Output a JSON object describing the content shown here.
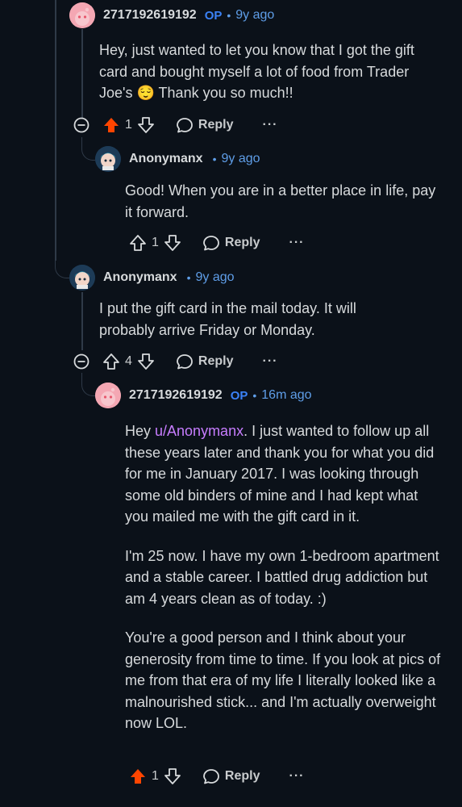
{
  "comments": [
    {
      "author": "2717192619192",
      "op_badge": "OP",
      "separator": "•",
      "time": "9y ago",
      "body": "Hey, just wanted to let you know that I got the gift card and bought myself a lot of food from Trader Joe's 😌 Thank you so much!!",
      "votes": "1",
      "upvoted": true,
      "reply_label": "Reply",
      "more_label": "···"
    },
    {
      "author": "Anonymanx",
      "separator": "•",
      "time": "9y ago",
      "body": "Good! When you are in a better place in life, pay it forward.",
      "votes": "1",
      "upvoted": false,
      "reply_label": "Reply",
      "more_label": "···"
    },
    {
      "author": "Anonymanx",
      "separator": "•",
      "time": "9y ago",
      "body": "I put the gift card in the mail today. It will probably arrive Friday or Monday.",
      "votes": "4",
      "upvoted": false,
      "reply_label": "Reply",
      "more_label": "···"
    },
    {
      "author": "2717192619192",
      "op_badge": "OP",
      "separator": "•",
      "time": "16m ago",
      "body_p1_prefix": "Hey ",
      "mention": "u/Anonymanx",
      "body_p1_suffix": ". I just wanted to follow up all these years later and thank you for what you did for me in January 2017. I was looking through some old binders of mine and I had kept what you mailed me with the gift card in it.",
      "body_p2": "I'm 25 now. I have my own 1-bedroom apartment and a stable career. I battled drug addiction but am 4 years clean as of today. :)",
      "body_p3": "You're a good person and I think about your generosity from time to time. If you look at pics of me from that era of my life I literally looked like a malnourished stick... and I'm actually overweight now LOL.",
      "votes": "1",
      "upvoted": true,
      "reply_label": "Reply",
      "more_label": "···"
    }
  ],
  "colors": {
    "upvote": "#ff4500",
    "accent": "#5f9ee8",
    "mention": "#c77dff",
    "background": "#0b1119"
  }
}
